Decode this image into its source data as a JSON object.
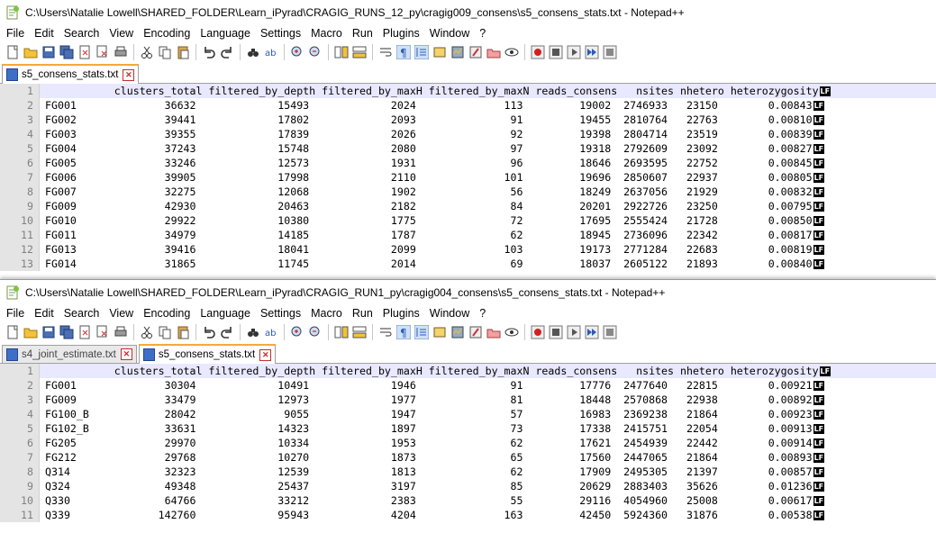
{
  "windows": [
    {
      "title": "C:\\Users\\Natalie Lowell\\SHARED_FOLDER\\Learn_iPyrad\\CRAGIG_RUNS_12_py\\cragig009_consens\\s5_consens_stats.txt - Notepad++",
      "menu": [
        "File",
        "Edit",
        "Search",
        "View",
        "Encoding",
        "Language",
        "Settings",
        "Macro",
        "Run",
        "Plugins",
        "Window",
        "?"
      ],
      "tabs": [
        {
          "label": "s5_consens_stats.txt",
          "active": true
        }
      ],
      "lines": [
        {
          "n": "1",
          "text": "           clusters_total filtered_by_depth filtered_by_maxH filtered_by_maxN reads_consens   nsites nhetero heterozygosity"
        },
        {
          "n": "2",
          "text": "FG001              36632             15493             2024              113         19002  2746933   23150        0.00843"
        },
        {
          "n": "3",
          "text": "FG002              39441             17802             2093               91         19455  2810764   22763        0.00810"
        },
        {
          "n": "4",
          "text": "FG003              39355             17839             2026               92         19398  2804714   23519        0.00839"
        },
        {
          "n": "5",
          "text": "FG004              37243             15748             2080               97         19318  2792609   23092        0.00827"
        },
        {
          "n": "6",
          "text": "FG005              33246             12573             1931               96         18646  2693595   22752        0.00845"
        },
        {
          "n": "7",
          "text": "FG006              39905             17998             2110              101         19696  2850607   22937        0.00805"
        },
        {
          "n": "8",
          "text": "FG007              32275             12068             1902               56         18249  2637056   21929        0.00832"
        },
        {
          "n": "9",
          "text": "FG009              42930             20463             2182               84         20201  2922726   23250        0.00795"
        },
        {
          "n": "10",
          "text": "FG010              29922             10380             1775               72         17695  2555424   21728        0.00850"
        },
        {
          "n": "11",
          "text": "FG011              34979             14185             1787               62         18945  2736096   22342        0.00817"
        },
        {
          "n": "12",
          "text": "FG013              39416             18041             2099              103         19173  2771284   22683        0.00819"
        },
        {
          "n": "13",
          "text": "FG014              31865             11745             2014               69         18037  2605122   21893        0.00840"
        }
      ]
    },
    {
      "title": "C:\\Users\\Natalie Lowell\\SHARED_FOLDER\\Learn_iPyrad\\CRAGIG_RUN1_py\\cragig004_consens\\s5_consens_stats.txt - Notepad++",
      "menu": [
        "File",
        "Edit",
        "Search",
        "View",
        "Encoding",
        "Language",
        "Settings",
        "Macro",
        "Run",
        "Plugins",
        "Window",
        "?"
      ],
      "tabs": [
        {
          "label": "s4_joint_estimate.txt",
          "active": false
        },
        {
          "label": "s5_consens_stats.txt",
          "active": true
        }
      ],
      "lines": [
        {
          "n": "1",
          "text": "           clusters_total filtered_by_depth filtered_by_maxH filtered_by_maxN reads_consens   nsites nhetero heterozygosity"
        },
        {
          "n": "2",
          "text": "FG001              30304             10491             1946               91         17776  2477640   22815        0.00921"
        },
        {
          "n": "3",
          "text": "FG009              33479             12973             1977               81         18448  2570868   22938        0.00892"
        },
        {
          "n": "4",
          "text": "FG100_B            28042              9055             1947               57         16983  2369238   21864        0.00923"
        },
        {
          "n": "5",
          "text": "FG102_B            33631             14323             1897               73         17338  2415751   22054        0.00913"
        },
        {
          "n": "6",
          "text": "FG205              29970             10334             1953               62         17621  2454939   22442        0.00914"
        },
        {
          "n": "7",
          "text": "FG212              29768             10270             1873               65         17560  2447065   21864        0.00893"
        },
        {
          "n": "8",
          "text": "Q314               32323             12539             1813               62         17909  2495305   21397        0.00857"
        },
        {
          "n": "9",
          "text": "Q324               49348             25437             3197               85         20629  2883403   35626        0.01236"
        },
        {
          "n": "10",
          "text": "Q330               64766             33212             2383               55         29116  4054960   25008        0.00617"
        },
        {
          "n": "11",
          "text": "Q339              142760             95943             4204              163         42450  5924360   31876        0.00538"
        }
      ]
    }
  ],
  "eol_label": "LF",
  "colors": {
    "tab_accent": "#f4a93a",
    "gutter": "#e4e4e4",
    "current_line": "#e8e8ff"
  }
}
